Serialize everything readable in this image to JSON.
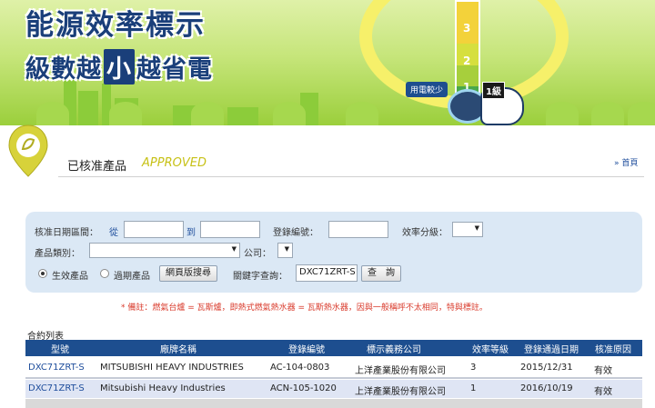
{
  "banner": {
    "title_line1": "能源效率標示",
    "title_line2_a": "級數越",
    "title_line2_b": "小",
    "title_line2_c": "越省電",
    "use_less_label": "用電較少",
    "level_badge": "1級",
    "gauge_levels": [
      "3",
      "2",
      "1"
    ]
  },
  "crumb": {
    "title": "已核准產品",
    "title_en": "APPROVED",
    "home_link": "» 首頁"
  },
  "form": {
    "date_range_label": "核准日期區間：",
    "from_label": "從",
    "from_value": "",
    "to_label": "到",
    "to_value": "",
    "reg_no_label": "登錄編號：",
    "reg_no_value": "",
    "efficiency_label": "效率分級：",
    "efficiency_value": "",
    "category_label": "產品類別：",
    "category_value": "",
    "company_label": "公司：",
    "company_value": "",
    "radio_active": "生效產品",
    "radio_expired": "過期產品",
    "search_web_button": "網頁版搜尋",
    "keyword_label": "關鍵字查詢：",
    "keyword_value": "DXC71ZRT-S",
    "query_button": "查　詢"
  },
  "note": "* 備註：燃氣台爐 = 瓦斯爐，即熱式燃氣熱水器 = 瓦斯熱水器，因與一般稱呼不太相同，特與標註。",
  "table": {
    "title": "合約列表",
    "columns": [
      "型號",
      "廠牌名稱",
      "登錄編號",
      "標示義務公司",
      "效率等級",
      "登錄通過日期",
      "核准原因"
    ],
    "rows": [
      [
        "DXC71ZRT-S",
        "MITSUBISHI HEAVY INDUSTRIES",
        "AC-104-0803",
        "上洋產業股份有限公司",
        "3",
        "2015/12/31",
        "有效"
      ],
      [
        "DXC71ZRT-S",
        "Mitsubishi Heavy Industries",
        "ACN-105-1020",
        "上洋產業股份有限公司",
        "1",
        "2016/10/19",
        "有效"
      ]
    ]
  },
  "colors": {
    "header_blue": "#1d4e8f",
    "form_bg": "#dbe8f5",
    "note_red": "#d93a2b",
    "approved_yellow": "#c7c116",
    "banner_green": "#9bcf3c"
  }
}
